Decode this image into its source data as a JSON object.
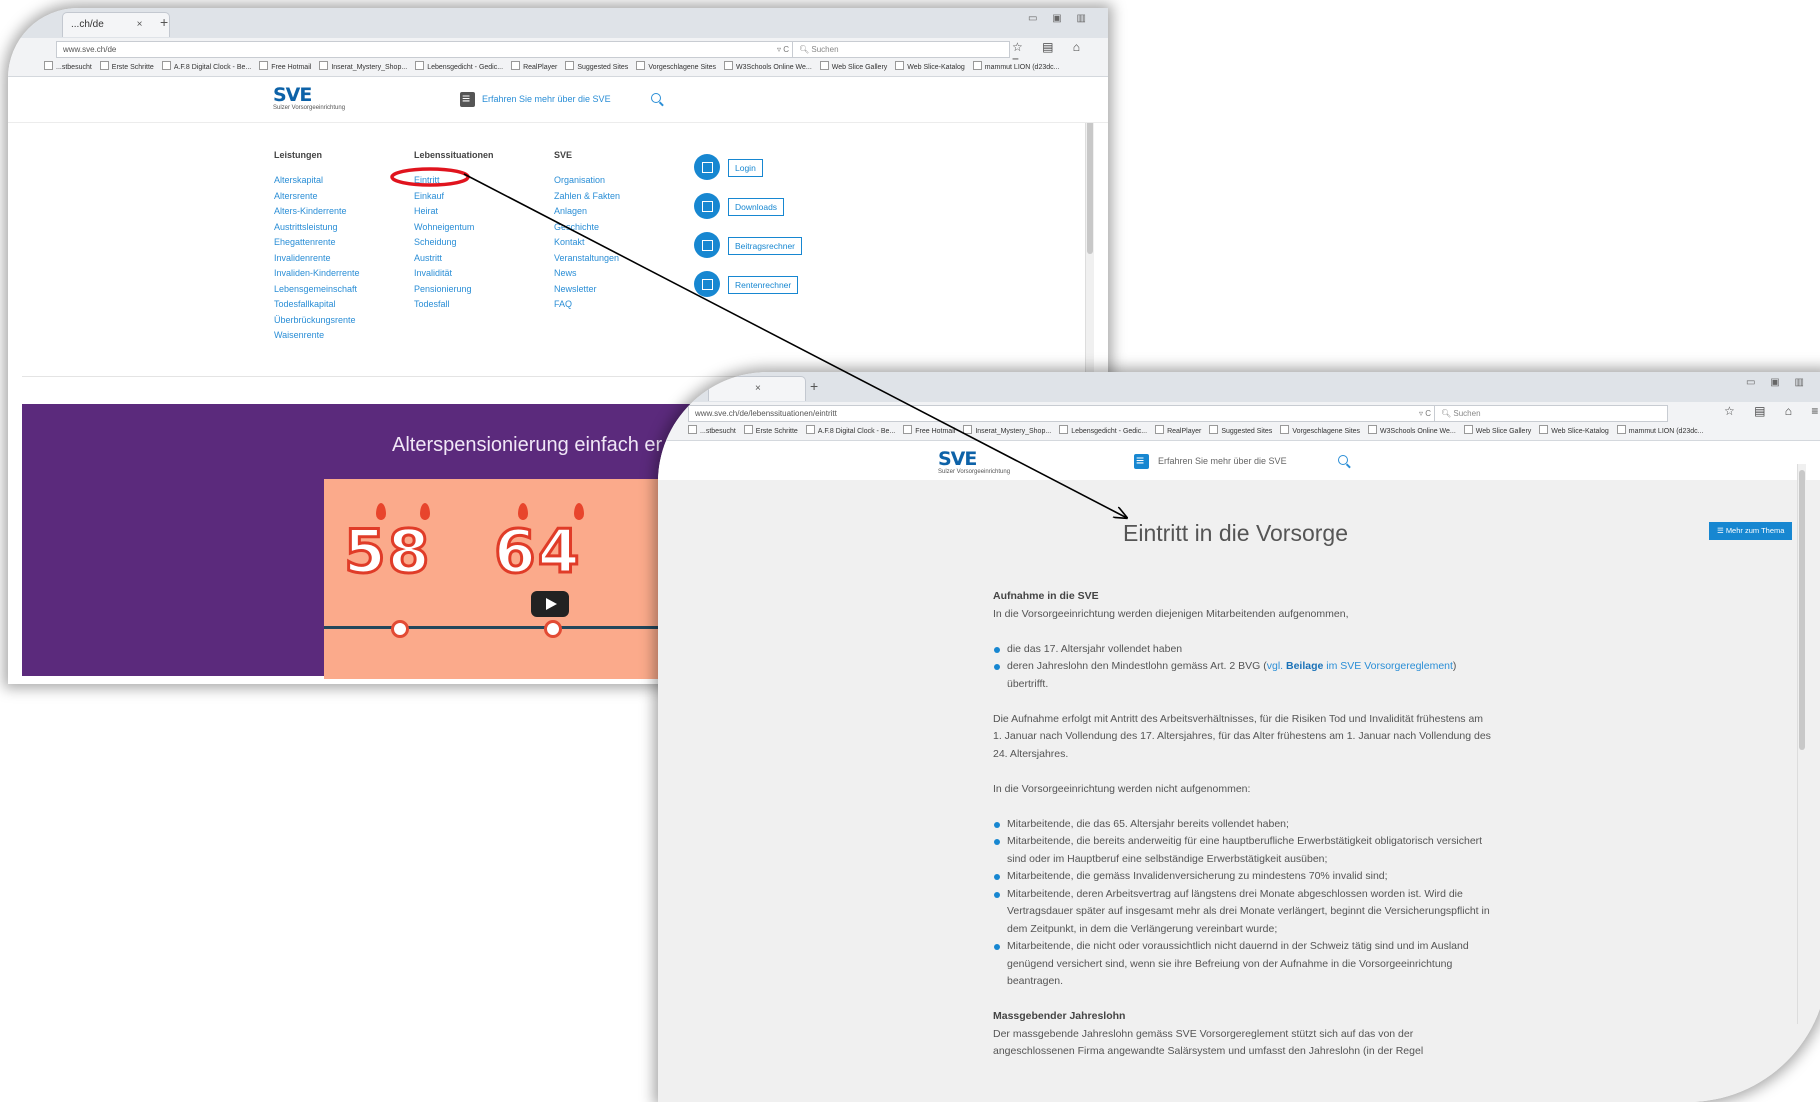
{
  "shot1": {
    "tab_title": "...ch/de",
    "tab_close": "×",
    "tab_new": "+",
    "url": "www.sve.ch/de",
    "search_placeholder": "Suchen",
    "bookmarks": [
      "...stbesucht",
      "Erste Schritte",
      "A.F.8 Digital Clock - Be...",
      "Free Hotmail",
      "Inserat_Mystery_Shop...",
      "Lebensgedicht - Gedic...",
      "RealPlayer",
      "Suggested Sites",
      "Vorgeschlagene Sites",
      "W3Schools Online We...",
      "Web Slice Gallery",
      "Web Slice-Katalog",
      "mammut LION (d23dc..."
    ],
    "logo": {
      "text": "SVE",
      "subtitle": "Sulzer Vorsorgeeinrichtung"
    },
    "menu_label": "Erfahren Sie mehr über die SVE",
    "columns": [
      {
        "heading": "Leistungen",
        "items": [
          "Alterskapital",
          "Altersrente",
          "Alters-Kinderrente",
          "Austrittsleistung",
          "Ehegattenrente",
          "Invalidenrente",
          "Invaliden-Kinderrente",
          "Lebensgemeinschaft",
          "Todesfallkapital",
          "Überbrückungsrente",
          "Waisenrente"
        ]
      },
      {
        "heading": "Lebenssituationen",
        "items": [
          "Eintritt",
          "Einkauf",
          "Heirat",
          "Wohneigentum",
          "Scheidung",
          "Austritt",
          "Invalidität",
          "Pensionierung",
          "Todesfall"
        ]
      },
      {
        "heading": "SVE",
        "items": [
          "Organisation",
          "Zahlen & Fakten",
          "Anlagen",
          "Geschichte",
          "Kontakt",
          "Veranstaltungen",
          "News",
          "Newsletter",
          "FAQ"
        ]
      }
    ],
    "quick_buttons": [
      "Login",
      "Downloads",
      "Beitragsrechner",
      "Rentenrechner"
    ],
    "banner_title": "Alterspensionierung einfach er",
    "video_numbers": [
      "58",
      "64"
    ],
    "highlight_color": "#e0141e"
  },
  "shot2": {
    "tab_close": "×",
    "tab_new": "+",
    "url": "www.sve.ch/de/lebenssituationen/eintritt",
    "search_placeholder": "Suchen",
    "bookmarks": [
      "...stbesucht",
      "Erste Schritte",
      "A.F.8 Digital Clock - Be...",
      "Free Hotmail",
      "Inserat_Mystery_Shop...",
      "Lebensgedicht - Gedic...",
      "RealPlayer",
      "Suggested Sites",
      "Vorgeschlagene Sites",
      "W3Schools Online We...",
      "Web Slice Gallery",
      "Web Slice-Katalog",
      "mammut LION (d23dc..."
    ],
    "logo": {
      "text": "SVE",
      "subtitle": "Sulzer Vorsorgeeinrichtung"
    },
    "menu_label": "Erfahren Sie mehr über die SVE",
    "page_title": "Eintritt in die Vorsorge",
    "mehr_button": "Mehr zum Thema",
    "article": {
      "heading1": "Aufnahme in die SVE",
      "intro": "In die Vorsorgeeinrichtung werden diejenigen Mitarbeitenden aufgenommen,",
      "bullet1": "die das 17. Altersjahr vollendet haben",
      "bullet2_pre": "deren Jahreslohn den Mindestlohn gemäss Art. 2 BVG (",
      "bullet2_link1": "vgl. ",
      "bullet2_link_bold": "Beilage",
      "bullet2_link2": " im SVE Vorsorgereglement",
      "bullet2_post": ") übertrifft.",
      "para1": "Die Aufnahme erfolgt mit Antritt des Arbeitsverhältnisses, für die Risiken Tod und Invalidität frühestens am 1. Januar nach Vollendung des 17. Altersjahres, für das Alter frühestens am 1. Januar nach Vollendung des 24. Altersjahres.",
      "para2": "In die Vorsorgeeinrichtung werden nicht aufgenommen:",
      "excluded": [
        "Mitarbeitende, die das 65. Altersjahr bereits vollendet haben;",
        "Mitarbeitende, die bereits anderweitig für eine hauptberufliche Erwerbstätigkeit obligatorisch versichert sind oder im Hauptberuf eine selbständige Erwerbstätigkeit ausüben;",
        "Mitarbeitende, die gemäss Invalidenversicherung zu mindestens 70% invalid sind;",
        "Mitarbeitende, deren Arbeitsvertrag auf längstens drei Monate abgeschlossen worden ist. Wird die Vertragsdauer später auf insgesamt mehr als drei Monate verlängert, beginnt die Versicherungspflicht in dem Zeitpunkt, in dem die Verlängerung vereinbart wurde;",
        "Mitarbeitende, die nicht oder voraussichtlich nicht dauernd in der Schweiz tätig sind und im Ausland genügend versichert sind, wenn sie ihre Befreiung von der Aufnahme in die Vorsorgeeinrichtung beantragen."
      ],
      "heading2": "Massgebender Jahreslohn",
      "para3": "Der massgebende Jahreslohn gemäss SVE Vorsorgereglement stützt sich auf das von der angeschlossenen Firma angewandte Salärsystem und umfasst den Jahreslohn (in der Regel"
    }
  },
  "colors": {
    "brand_blue": "#0d62a8",
    "link_blue": "#2a8ed6",
    "button_blue": "#1787d1",
    "banner_purple": "#5b2a7c",
    "video_peach": "#fbaa8b",
    "annotation_red": "#e0141e",
    "content_grey": "#f0f0f0"
  },
  "icons": [
    "menu-icon",
    "search-icon",
    "star-icon",
    "reading-list-icon",
    "home-icon",
    "hamburger-icon",
    "play-icon"
  ]
}
